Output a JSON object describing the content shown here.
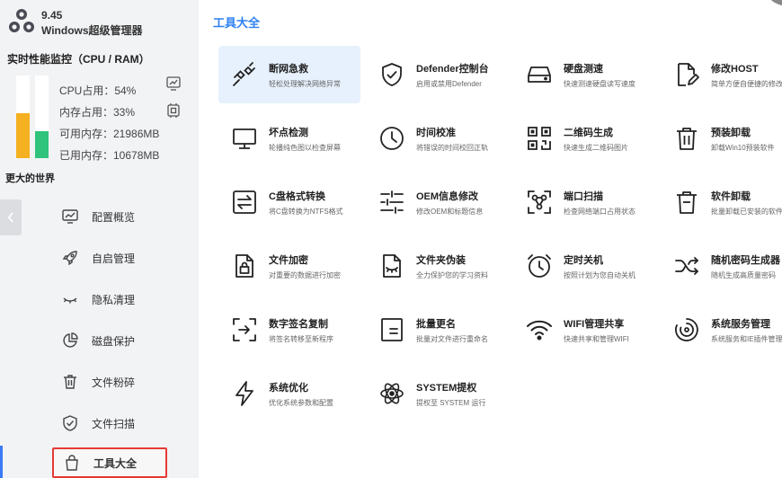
{
  "app": {
    "version": "9.45",
    "name": "Windows超级管理器"
  },
  "monitor": {
    "title": "实时性能监控（CPU / RAM）",
    "cpu_label": "CPU占用：54%",
    "ram_label": "内存占用：33%",
    "available_label": "可用内存：21986MB",
    "used_label": "已用内存：10678MB",
    "cpu_percent": 54,
    "ram_percent": 33
  },
  "sidebar": {
    "section_title": "更大的世界",
    "items": [
      {
        "label": "配置概览"
      },
      {
        "label": "自启管理"
      },
      {
        "label": "隐私清理"
      },
      {
        "label": "磁盘保护"
      },
      {
        "label": "文件粉碎"
      },
      {
        "label": "文件扫描"
      },
      {
        "label": "工具大全"
      }
    ]
  },
  "main": {
    "title": "工具大全"
  },
  "tools": [
    {
      "name": "断网急救",
      "desc": "轻松处理解决网络异常"
    },
    {
      "name": "Defender控制台",
      "desc": "启用或禁用Defender"
    },
    {
      "name": "硬盘测速",
      "desc": "快速测速硬盘读写速度"
    },
    {
      "name": "修改HOST",
      "desc": "简单方便自便捷的修改"
    },
    {
      "name": "坏点检测",
      "desc": "轮播纯色图以检查屏幕"
    },
    {
      "name": "时间校准",
      "desc": "将错误的时间校回正轨"
    },
    {
      "name": "二维码生成",
      "desc": "快速生成二维码图片"
    },
    {
      "name": "预装卸载",
      "desc": "卸载Win10预装软件"
    },
    {
      "name": "C盘格式转换",
      "desc": "将C盘转换为NTFS格式"
    },
    {
      "name": "OEM信息修改",
      "desc": "修改OEM和标题信息"
    },
    {
      "name": "端口扫描",
      "desc": "检查网络端口占用状态"
    },
    {
      "name": "软件卸载",
      "desc": "批量卸载已安装的软件"
    },
    {
      "name": "文件加密",
      "desc": "对重要的数据进行加密"
    },
    {
      "name": "文件夹伪装",
      "desc": "全力保护您的学习资料"
    },
    {
      "name": "定时关机",
      "desc": "按照计划为您自动关机"
    },
    {
      "name": "随机密码生成器",
      "desc": "随机生成高质量密码"
    },
    {
      "name": "数字签名复制",
      "desc": "将签名转移至新程序"
    },
    {
      "name": "批量更名",
      "desc": "批量对文件进行重命名"
    },
    {
      "name": "WIFI管理共享",
      "desc": "快速共享和管理WIFI"
    },
    {
      "name": "系统服务管理",
      "desc": "系统服务和IE插件管理"
    },
    {
      "name": "系统优化",
      "desc": "优化系统参数和配置"
    },
    {
      "name": "SYSTEM提权",
      "desc": "提权至 SYSTEM 运行"
    }
  ],
  "colors": {
    "accent": "#2b7ff0",
    "cpu_bar": "#f5b121",
    "ram_bar": "#2fc37c",
    "highlight_border": "#e53935"
  }
}
